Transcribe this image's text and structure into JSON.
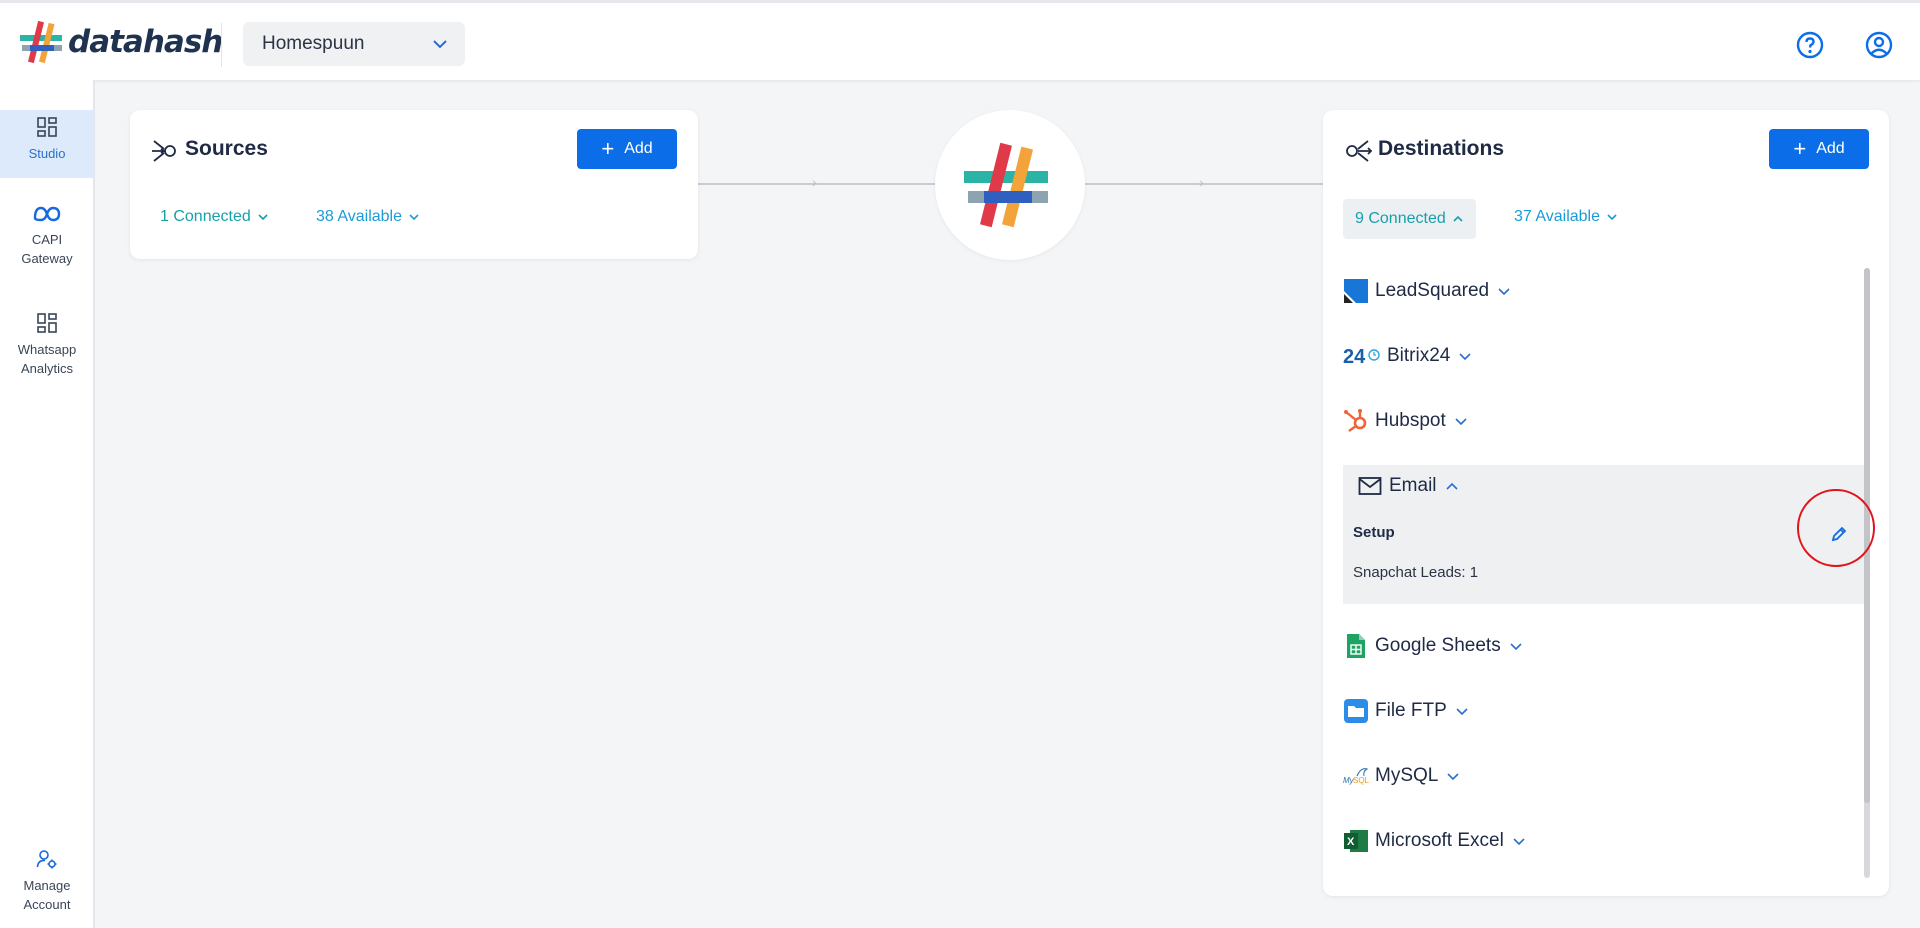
{
  "app": {
    "logo_text": "datahash",
    "workspace": "Homespuun"
  },
  "sidebar": {
    "items": [
      {
        "label": "Studio",
        "icon": "dashboard-icon",
        "active": true
      },
      {
        "label": "CAPI Gateway",
        "icon": "meta-icon",
        "active": false
      },
      {
        "label": "Whatsapp Analytics",
        "icon": "dashboard-icon",
        "active": false
      },
      {
        "label": "Manage Account",
        "icon": "user-settings-icon",
        "active": false
      }
    ]
  },
  "sources": {
    "title": "Sources",
    "add_label": "Add",
    "connected": "1 Connected",
    "available": "38 Available"
  },
  "destinations": {
    "title": "Destinations",
    "add_label": "Add",
    "connected": "9 Connected",
    "available": "37 Available",
    "items": [
      {
        "name": "LeadSquared",
        "icon": "leadsquared-icon"
      },
      {
        "name": "Bitrix24",
        "icon": "bitrix24-icon"
      },
      {
        "name": "Hubspot",
        "icon": "hubspot-icon"
      },
      {
        "name": "Email",
        "icon": "mail-icon",
        "expanded": true
      },
      {
        "name": "Google Sheets",
        "icon": "google-sheets-icon"
      },
      {
        "name": "File FTP",
        "icon": "folder-icon"
      },
      {
        "name": "MySQL",
        "icon": "mysql-icon"
      },
      {
        "name": "Microsoft Excel",
        "icon": "excel-icon"
      }
    ],
    "expanded_detail": {
      "setup_label": "Setup",
      "setup_value": "Snapchat Leads: 1"
    }
  },
  "colors": {
    "accent": "#0b6ee8",
    "teal": "#18a0a8",
    "annotation": "#e0141b"
  }
}
